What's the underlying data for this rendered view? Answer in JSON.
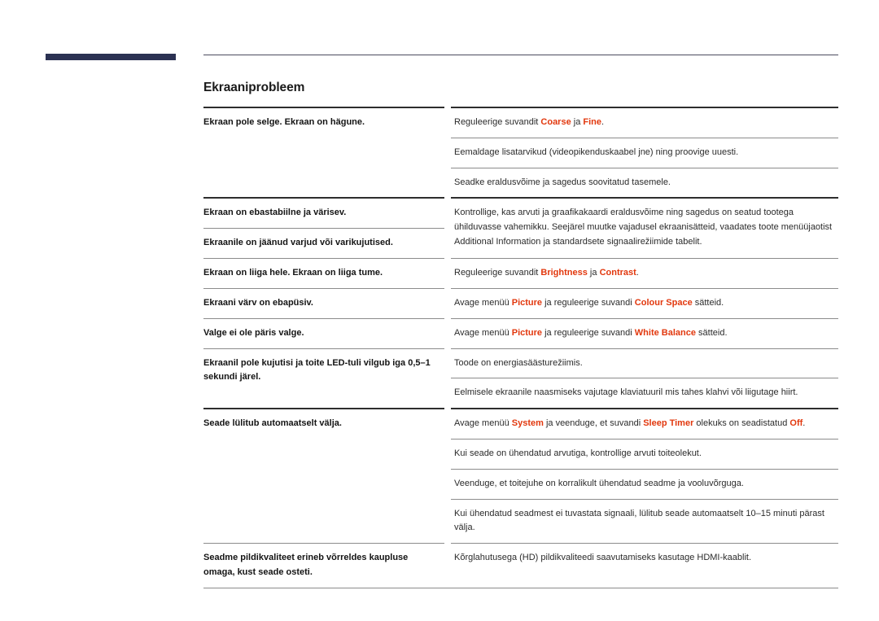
{
  "document": {
    "heading": "Ekraaniprobleem",
    "accent_navy": "#2b3152",
    "accent_red": "#e2380e"
  },
  "table": {
    "sections": [
      {
        "label": "Ekraan pole selge. Ekraan on hägune.",
        "label_rows": 1,
        "solutions": [
          {
            "parts": [
              {
                "t": "Reguleerige suvandit ",
                "hl": false
              },
              {
                "t": "Coarse",
                "hl": true
              },
              {
                "t": " ja ",
                "hl": false
              },
              {
                "t": "Fine",
                "hl": true
              },
              {
                "t": ".",
                "hl": false
              }
            ]
          },
          {
            "parts": [
              {
                "t": "Eemaldage lisatarvikud (videopikenduskaabel jne) ning proovige uuesti.",
                "hl": false
              }
            ]
          },
          {
            "parts": [
              {
                "t": "Seadke eraldusvõime ja sagedus soovitatud tasemele.",
                "hl": false
              }
            ]
          }
        ]
      },
      {
        "label": "Ekraan on ebastabiilne ja värisev.",
        "label2": "Ekraanile on jäänud varjud või varikujutised.",
        "label_rows": 2,
        "solutions": [
          {
            "parts": [
              {
                "t": "Kontrollige, kas arvuti ja graafikakaardi eraldusvõime ning sagedus on seatud tootega ühilduvasse vahemikku. Seejärel muutke vajadusel ekraanisätteid, vaadates toote menüüjaotist Additional Information ja standardsete signaalirežiimide tabelit.",
                "hl": false
              }
            ]
          }
        ]
      },
      {
        "label": "Ekraan on liiga hele. Ekraan on liiga tume.",
        "label_rows": 1,
        "solutions": [
          {
            "parts": [
              {
                "t": "Reguleerige suvandit ",
                "hl": false
              },
              {
                "t": "Brightness",
                "hl": true
              },
              {
                "t": " ja ",
                "hl": false
              },
              {
                "t": "Contrast",
                "hl": true
              },
              {
                "t": ".",
                "hl": false
              }
            ]
          }
        ]
      },
      {
        "label": "Ekraani värv on ebapüsiv.",
        "label_rows": 1,
        "solutions": [
          {
            "parts": [
              {
                "t": "Avage menüü ",
                "hl": false
              },
              {
                "t": "Picture",
                "hl": true
              },
              {
                "t": " ja reguleerige suvandi ",
                "hl": false
              },
              {
                "t": "Colour Space",
                "hl": true
              },
              {
                "t": " sätteid.",
                "hl": false
              }
            ]
          }
        ]
      },
      {
        "label": "Valge ei ole päris valge.",
        "label_rows": 1,
        "solutions": [
          {
            "parts": [
              {
                "t": "Avage menüü ",
                "hl": false
              },
              {
                "t": "Picture",
                "hl": true
              },
              {
                "t": " ja reguleerige suvandi ",
                "hl": false
              },
              {
                "t": "White Balance",
                "hl": true
              },
              {
                "t": " sätteid.",
                "hl": false
              }
            ]
          }
        ]
      },
      {
        "label": "Ekraanil pole kujutisi ja toite LED-tuli vilgub iga 0,5–1 sekundi järel.",
        "label_rows": 1,
        "solutions": [
          {
            "parts": [
              {
                "t": "Toode on energiasäästurežiimis.",
                "hl": false
              }
            ]
          },
          {
            "parts": [
              {
                "t": "Eelmisele ekraanile naasmiseks vajutage klaviatuuril mis tahes klahvi või liigutage hiirt.",
                "hl": false
              }
            ]
          }
        ]
      },
      {
        "label": "Seade lülitub automaatselt välja.",
        "label_rows": 1,
        "solutions": [
          {
            "parts": [
              {
                "t": "Avage menüü ",
                "hl": false
              },
              {
                "t": "System",
                "hl": true
              },
              {
                "t": " ja veenduge, et suvandi ",
                "hl": false
              },
              {
                "t": "Sleep Timer",
                "hl": true
              },
              {
                "t": " olekuks on seadistatud ",
                "hl": false
              },
              {
                "t": "Off",
                "hl": true
              },
              {
                "t": ".",
                "hl": false
              }
            ]
          },
          {
            "parts": [
              {
                "t": "Kui seade on ühendatud arvutiga, kontrollige arvuti toiteolekut.",
                "hl": false
              }
            ]
          },
          {
            "parts": [
              {
                "t": "Veenduge, et toitejuhe on korralikult ühendatud seadme ja vooluvõrguga.",
                "hl": false
              }
            ]
          },
          {
            "parts": [
              {
                "t": "Kui ühendatud seadmest ei tuvastata signaali, lülitub seade automaatselt 10–15 minuti pärast välja.",
                "hl": false
              }
            ]
          }
        ]
      },
      {
        "label": "Seadme pildikvaliteet erineb võrreldes kaupluse omaga, kust seade osteti.",
        "label_rows": 1,
        "solutions": [
          {
            "parts": [
              {
                "t": "Kõrglahutusega (HD) pildikvaliteedi saavutamiseks kasutage HDMI-kaablit.",
                "hl": false
              }
            ]
          }
        ]
      }
    ]
  }
}
